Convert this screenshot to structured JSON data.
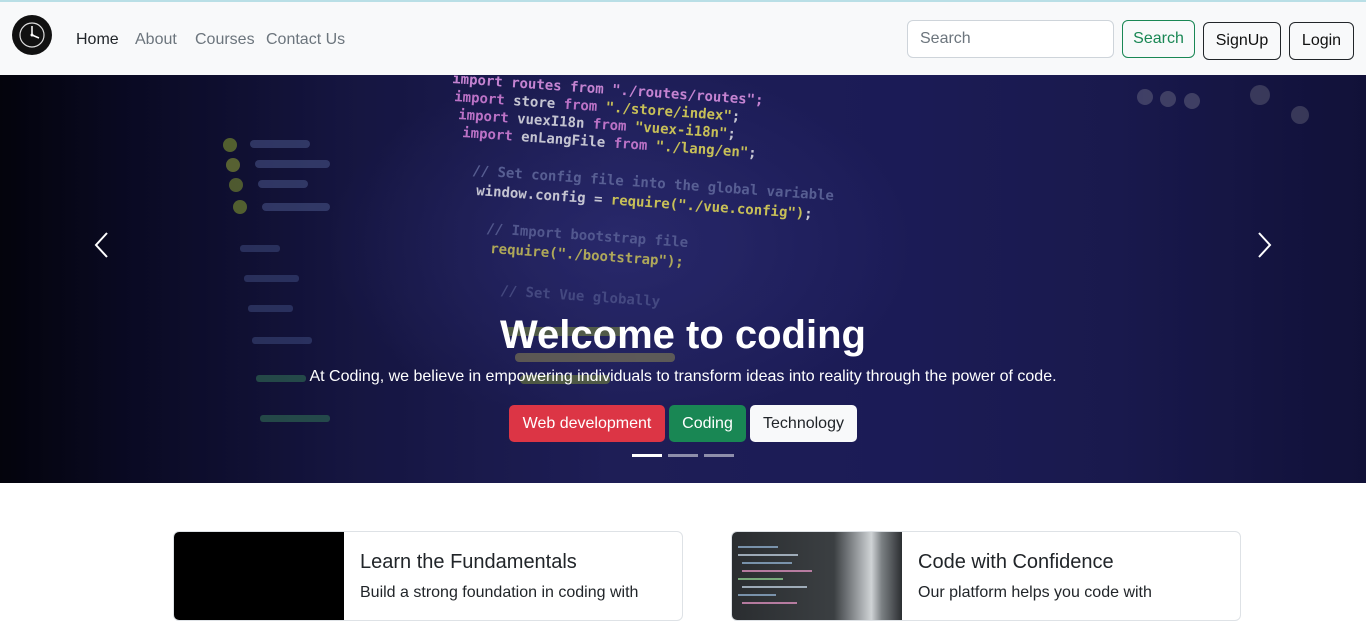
{
  "nav": {
    "links": [
      "Home",
      "About",
      "Courses",
      "Contact Us"
    ],
    "search_placeholder": "Search",
    "search_button": "Search",
    "signup_button": "SignUp",
    "login_button": "Login"
  },
  "hero": {
    "title": "Welcome to coding",
    "subtitle": "At Coding, we believe in empowering individuals to transform ideas into reality through the power of code.",
    "tags": [
      "Web development",
      "Coding",
      "Technology"
    ],
    "slide_count": 3,
    "active_slide": 1,
    "code_lines": [
      "import routes from \"./routes/routes\";",
      "import store from \"./store/index\";",
      "import vuexI18n from \"vuex-i18n\";",
      "import enLangFile from \"./lang/en\";",
      "// Set config file into the global variable",
      "window.config = require(\"./vue.config\");",
      "// Import bootstrap file",
      "require(\"./bootstrap\");",
      "// Set Vue globally"
    ]
  },
  "cards": [
    {
      "title": "Learn the Fundamentals",
      "text": "Build a strong foundation in coding with"
    },
    {
      "title": "Code with Confidence",
      "text": "Our platform helps you code with"
    }
  ],
  "colors": {
    "navbar_bg": "#f8f9fa",
    "success": "#198754",
    "danger": "#dc3545",
    "light": "#f8f9fa",
    "hero_bg": "#22226a"
  },
  "icons": {
    "logo": "clock-logo-icon",
    "prev": "chevron-left-icon",
    "next": "chevron-right-icon"
  }
}
